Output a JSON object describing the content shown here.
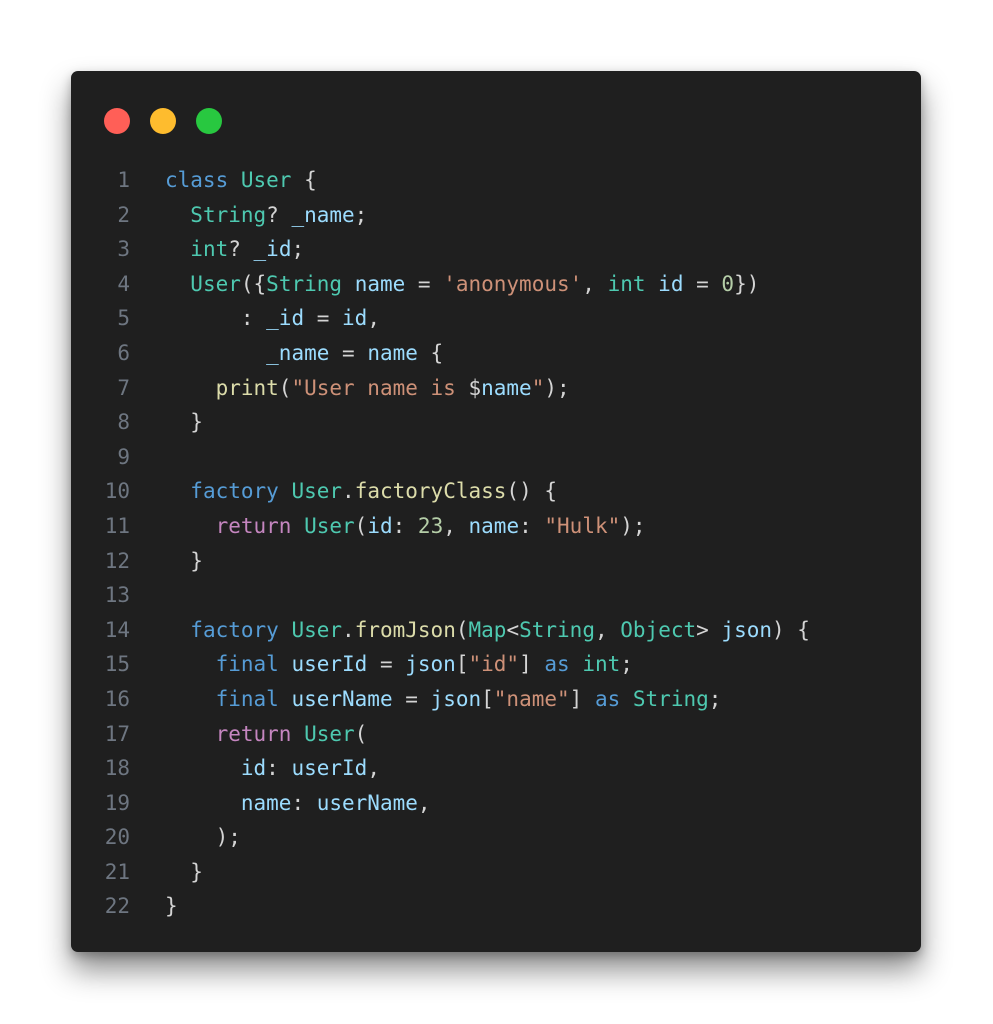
{
  "window": {
    "controls": [
      {
        "name": "close",
        "color": "#ff5f57"
      },
      {
        "name": "minimize",
        "color": "#febc2e"
      },
      {
        "name": "maximize",
        "color": "#28c840"
      }
    ],
    "background": "#1f1f1f"
  },
  "token_colors": {
    "kw": "#569cd6",
    "ctl": "#c586c0",
    "type": "#4ec9b0",
    "var": "#9cdcfe",
    "fn": "#dcdcaa",
    "str": "#ce9178",
    "num": "#b5cea8",
    "pun": "#d4d4d4"
  },
  "code": {
    "language": "dart",
    "lines": [
      {
        "n": "1",
        "tokens": [
          [
            "kw",
            "class"
          ],
          [
            "pun",
            " "
          ],
          [
            "type",
            "User"
          ],
          [
            "pun",
            " {"
          ]
        ]
      },
      {
        "n": "2",
        "tokens": [
          [
            "pun",
            "  "
          ],
          [
            "type",
            "String"
          ],
          [
            "pun",
            "? "
          ],
          [
            "var",
            "_name"
          ],
          [
            "pun",
            ";"
          ]
        ]
      },
      {
        "n": "3",
        "tokens": [
          [
            "pun",
            "  "
          ],
          [
            "type",
            "int"
          ],
          [
            "pun",
            "? "
          ],
          [
            "var",
            "_id"
          ],
          [
            "pun",
            ";"
          ]
        ]
      },
      {
        "n": "4",
        "tokens": [
          [
            "pun",
            "  "
          ],
          [
            "type",
            "User"
          ],
          [
            "pun",
            "({"
          ],
          [
            "type",
            "String"
          ],
          [
            "pun",
            " "
          ],
          [
            "var",
            "name"
          ],
          [
            "pun",
            " = "
          ],
          [
            "str",
            "'anonymous'"
          ],
          [
            "pun",
            ", "
          ],
          [
            "type",
            "int"
          ],
          [
            "pun",
            " "
          ],
          [
            "var",
            "id"
          ],
          [
            "pun",
            " = "
          ],
          [
            "num",
            "0"
          ],
          [
            "pun",
            "})"
          ]
        ]
      },
      {
        "n": "5",
        "tokens": [
          [
            "pun",
            "      : "
          ],
          [
            "var",
            "_id"
          ],
          [
            "pun",
            " = "
          ],
          [
            "var",
            "id"
          ],
          [
            "pun",
            ","
          ]
        ]
      },
      {
        "n": "6",
        "tokens": [
          [
            "pun",
            "        "
          ],
          [
            "var",
            "_name"
          ],
          [
            "pun",
            " = "
          ],
          [
            "var",
            "name"
          ],
          [
            "pun",
            " {"
          ]
        ]
      },
      {
        "n": "7",
        "tokens": [
          [
            "pun",
            "    "
          ],
          [
            "fn",
            "print"
          ],
          [
            "pun",
            "("
          ],
          [
            "str",
            "\"User name is "
          ],
          [
            "pun",
            "$"
          ],
          [
            "var",
            "name"
          ],
          [
            "str",
            "\""
          ],
          [
            "pun",
            ");"
          ]
        ]
      },
      {
        "n": "8",
        "tokens": [
          [
            "pun",
            "  }"
          ]
        ]
      },
      {
        "n": "9",
        "tokens": []
      },
      {
        "n": "10",
        "tokens": [
          [
            "pun",
            "  "
          ],
          [
            "kw",
            "factory"
          ],
          [
            "pun",
            " "
          ],
          [
            "type",
            "User"
          ],
          [
            "pun",
            "."
          ],
          [
            "fn",
            "factoryClass"
          ],
          [
            "pun",
            "() {"
          ]
        ]
      },
      {
        "n": "11",
        "tokens": [
          [
            "pun",
            "    "
          ],
          [
            "ctl",
            "return"
          ],
          [
            "pun",
            " "
          ],
          [
            "type",
            "User"
          ],
          [
            "pun",
            "("
          ],
          [
            "var",
            "id"
          ],
          [
            "pun",
            ": "
          ],
          [
            "num",
            "23"
          ],
          [
            "pun",
            ", "
          ],
          [
            "var",
            "name"
          ],
          [
            "pun",
            ": "
          ],
          [
            "str",
            "\"Hulk\""
          ],
          [
            "pun",
            ");"
          ]
        ]
      },
      {
        "n": "12",
        "tokens": [
          [
            "pun",
            "  }"
          ]
        ]
      },
      {
        "n": "13",
        "tokens": []
      },
      {
        "n": "14",
        "tokens": [
          [
            "pun",
            "  "
          ],
          [
            "kw",
            "factory"
          ],
          [
            "pun",
            " "
          ],
          [
            "type",
            "User"
          ],
          [
            "pun",
            "."
          ],
          [
            "fn",
            "fromJson"
          ],
          [
            "pun",
            "("
          ],
          [
            "type",
            "Map"
          ],
          [
            "pun",
            "<"
          ],
          [
            "type",
            "String"
          ],
          [
            "pun",
            ", "
          ],
          [
            "type",
            "Object"
          ],
          [
            "pun",
            "> "
          ],
          [
            "var",
            "json"
          ],
          [
            "pun",
            ") {"
          ]
        ]
      },
      {
        "n": "15",
        "tokens": [
          [
            "pun",
            "    "
          ],
          [
            "kw",
            "final"
          ],
          [
            "pun",
            " "
          ],
          [
            "var",
            "userId"
          ],
          [
            "pun",
            " = "
          ],
          [
            "var",
            "json"
          ],
          [
            "pun",
            "["
          ],
          [
            "str",
            "\"id\""
          ],
          [
            "pun",
            "] "
          ],
          [
            "kw",
            "as"
          ],
          [
            "pun",
            " "
          ],
          [
            "type",
            "int"
          ],
          [
            "pun",
            ";"
          ]
        ]
      },
      {
        "n": "16",
        "tokens": [
          [
            "pun",
            "    "
          ],
          [
            "kw",
            "final"
          ],
          [
            "pun",
            " "
          ],
          [
            "var",
            "userName"
          ],
          [
            "pun",
            " = "
          ],
          [
            "var",
            "json"
          ],
          [
            "pun",
            "["
          ],
          [
            "str",
            "\"name\""
          ],
          [
            "pun",
            "] "
          ],
          [
            "kw",
            "as"
          ],
          [
            "pun",
            " "
          ],
          [
            "type",
            "String"
          ],
          [
            "pun",
            ";"
          ]
        ]
      },
      {
        "n": "17",
        "tokens": [
          [
            "pun",
            "    "
          ],
          [
            "ctl",
            "return"
          ],
          [
            "pun",
            " "
          ],
          [
            "type",
            "User"
          ],
          [
            "pun",
            "("
          ]
        ]
      },
      {
        "n": "18",
        "tokens": [
          [
            "pun",
            "      "
          ],
          [
            "var",
            "id"
          ],
          [
            "pun",
            ": "
          ],
          [
            "var",
            "userId"
          ],
          [
            "pun",
            ","
          ]
        ]
      },
      {
        "n": "19",
        "tokens": [
          [
            "pun",
            "      "
          ],
          [
            "var",
            "name"
          ],
          [
            "pun",
            ": "
          ],
          [
            "var",
            "userName"
          ],
          [
            "pun",
            ","
          ]
        ]
      },
      {
        "n": "20",
        "tokens": [
          [
            "pun",
            "    );"
          ]
        ]
      },
      {
        "n": "21",
        "tokens": [
          [
            "pun",
            "  }"
          ]
        ]
      },
      {
        "n": "22",
        "tokens": [
          [
            "pun",
            "}"
          ]
        ]
      }
    ]
  }
}
